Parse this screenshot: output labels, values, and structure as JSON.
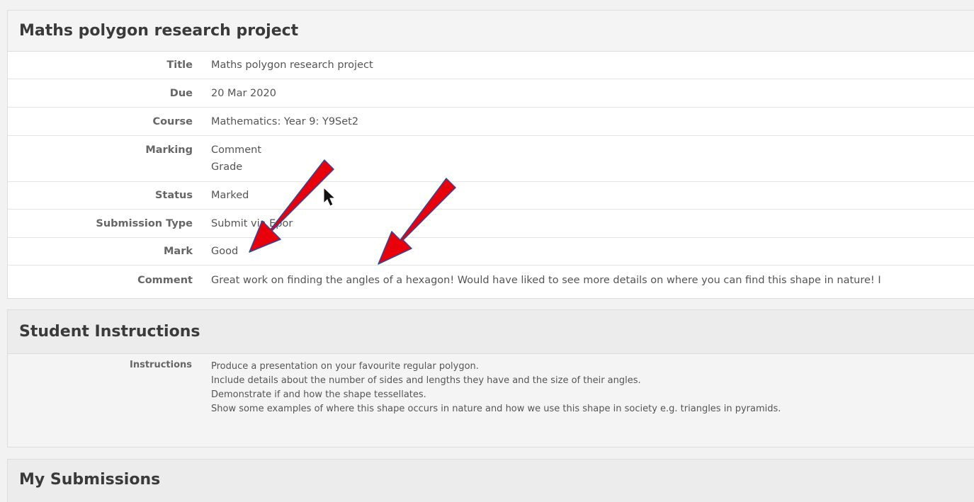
{
  "assignment": {
    "header": "Maths polygon research project",
    "fields": [
      {
        "label": "Title",
        "value": "Maths polygon research project"
      },
      {
        "label": "Due",
        "value": "20 Mar 2020"
      },
      {
        "label": "Course",
        "value": "Mathematics: Year 9: Y9Set2"
      },
      {
        "label": "Marking",
        "lines": [
          "Comment",
          "Grade"
        ]
      },
      {
        "label": "Status",
        "value": "Marked"
      },
      {
        "label": "Submission Type",
        "value": "Submit via Epor"
      },
      {
        "label": "Mark",
        "value": "Good"
      },
      {
        "label": "Comment",
        "value": "Great work on finding the angles of a hexagon! Would have liked to see more details on where you can find this shape in nature! I"
      }
    ]
  },
  "student_instructions": {
    "header": "Student Instructions",
    "label": "Instructions",
    "lines": [
      "Produce a presentation on your favourite regular polygon.",
      "Include details about the number of sides and lengths they have and the size of their angles.",
      "Demonstrate if and how the shape tessellates.",
      "Show some examples of where this shape occurs in nature and how we use this shape in society e.g. triangles in pyramids."
    ]
  },
  "my_submissions": {
    "header": "My Submissions"
  },
  "annotations": {
    "arrow_color": "#e8000b",
    "arrow_outline": "#2b4aa0",
    "icons": [
      "red-arrow-icon",
      "red-arrow-icon",
      "mouse-cursor-icon"
    ]
  }
}
